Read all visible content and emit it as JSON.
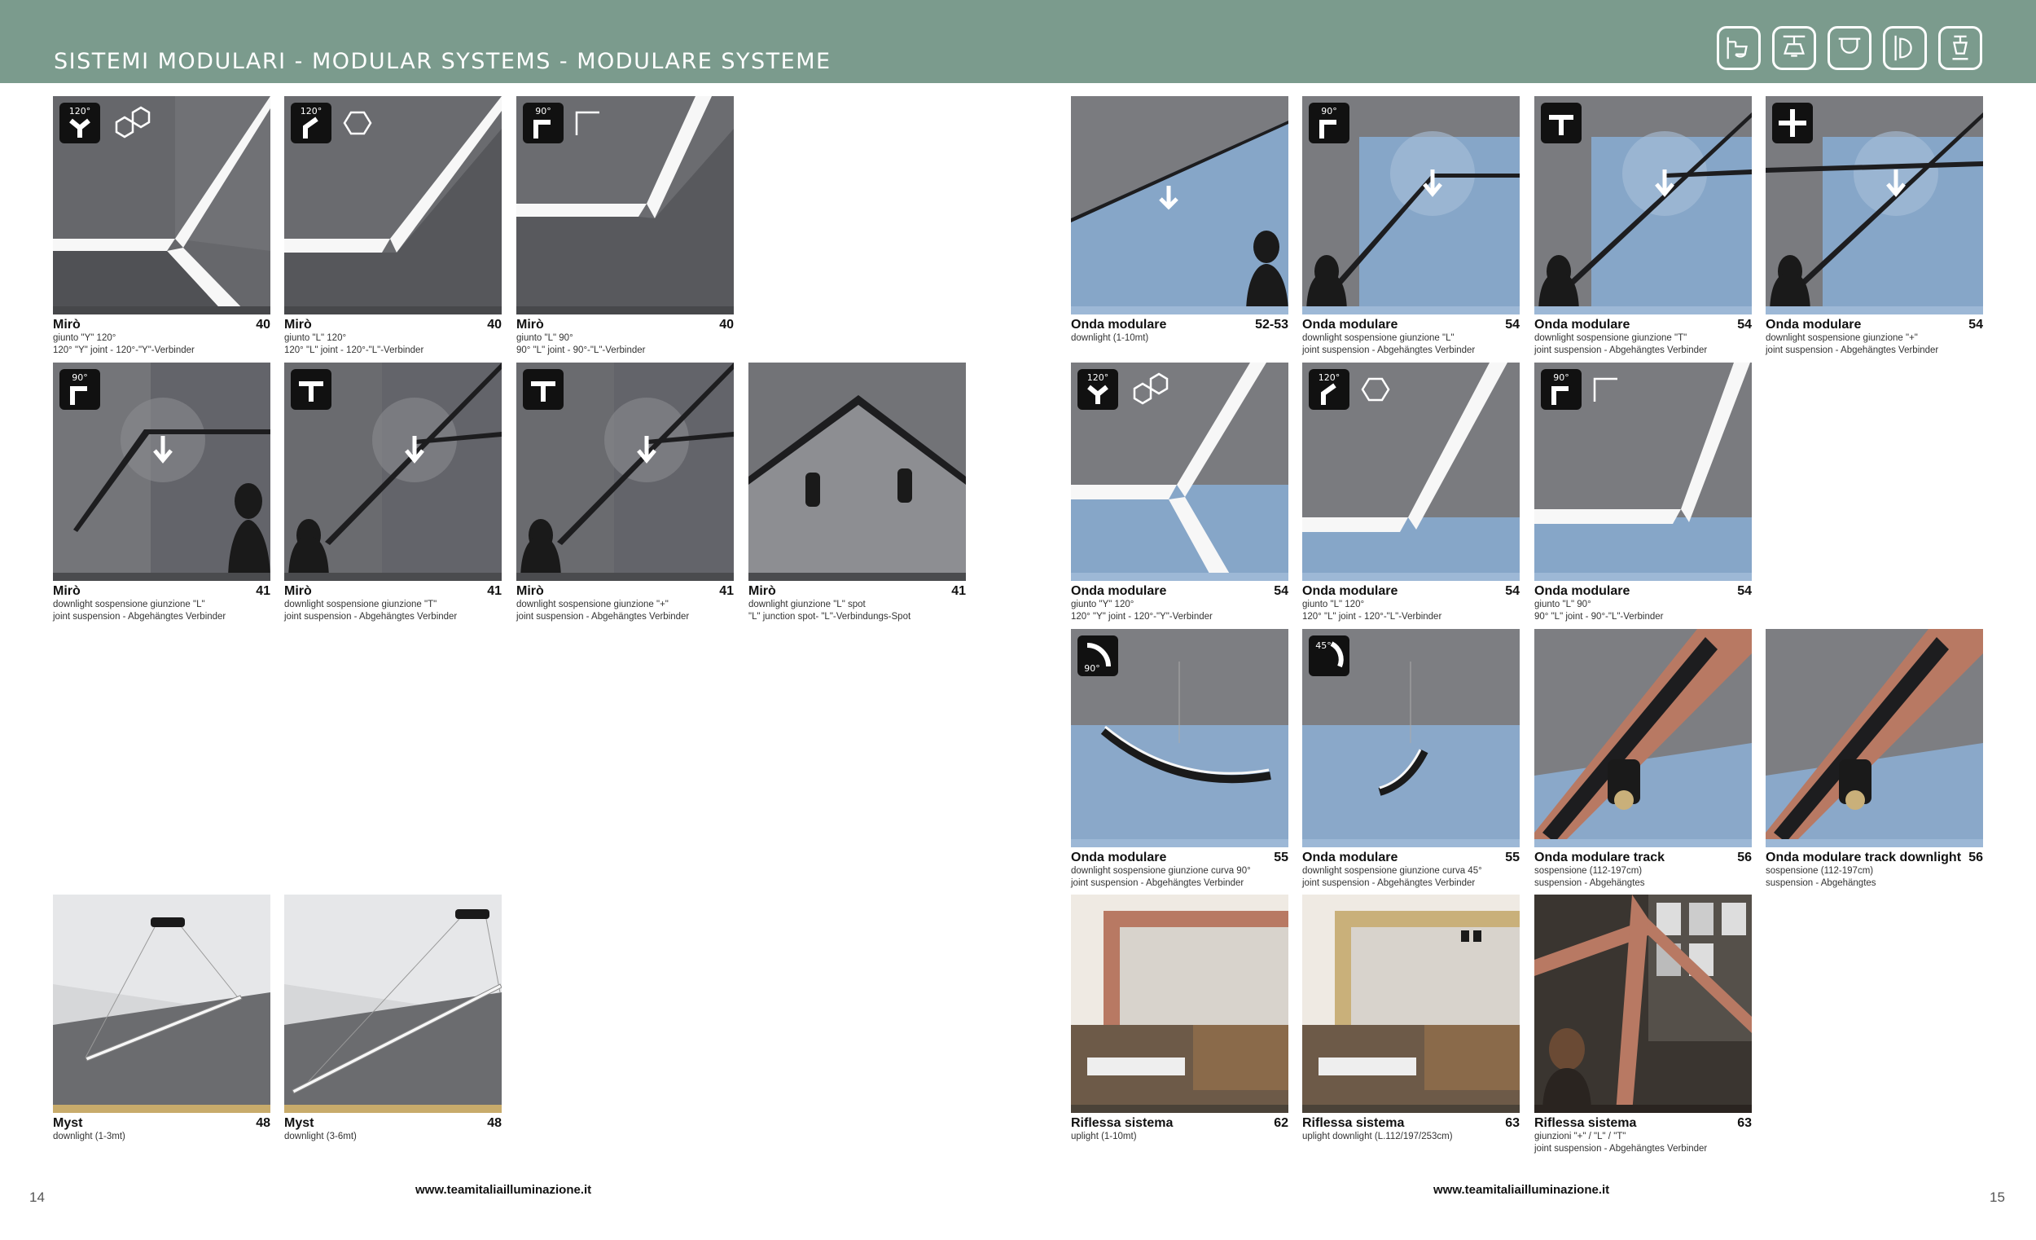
{
  "header": {
    "title": "SISTEMI MODULARI - MODULAR SYSTEMS - MODULARE SYSTEME",
    "icons": [
      "wall-ceiling-icon",
      "pendant-icon",
      "recessed-icon",
      "wall-icon",
      "floor-lamp-icon"
    ]
  },
  "colors": {
    "header": "#7b9b8d",
    "photo_dark": "#5d5e61",
    "photo_blue": "#7fa0c4",
    "copper": "#b87963",
    "gold": "#c9b07a"
  },
  "badges": {
    "y120": "120°",
    "l120": "120°",
    "l90": "90°",
    "curve90": "90°",
    "curve45": "45°"
  },
  "products": [
    {
      "name": "Mirò",
      "page": "40",
      "desc": [
        "giunto \"Y\" 120°",
        "120° \"Y\" joint - 120°-\"Y\"-Verbinder"
      ]
    },
    {
      "name": "Mirò",
      "page": "40",
      "desc": [
        "giunto \"L\" 120°",
        "120° \"L\" joint - 120°-\"L\"-Verbinder"
      ]
    },
    {
      "name": "Mirò",
      "page": "40",
      "desc": [
        "giunto \"L\" 90°",
        "90° \"L\" joint - 90°-\"L\"-Verbinder"
      ]
    },
    {
      "name": "Mirò",
      "page": "41",
      "desc": [
        "downlight sospensione giunzione \"L\"",
        "joint suspension - Abgehängtes Verbinder"
      ]
    },
    {
      "name": "Mirò",
      "page": "41",
      "desc": [
        "downlight sospensione giunzione \"T\"",
        "joint suspension - Abgehängtes Verbinder"
      ]
    },
    {
      "name": "Mirò",
      "page": "41",
      "desc": [
        "downlight sospensione giunzione \"+\"",
        "joint suspension - Abgehängtes Verbinder"
      ]
    },
    {
      "name": "Mirò",
      "page": "41",
      "desc": [
        "downlight giunzione \"L\" spot",
        "\"L\" junction spot- \"L\"-Verbindungs-Spot"
      ]
    },
    {
      "name": "Myst",
      "page": "48",
      "desc": [
        "downlight (1-3mt)"
      ]
    },
    {
      "name": "Myst",
      "page": "48",
      "desc": [
        "downlight (3-6mt)"
      ]
    },
    {
      "name": "Onda modulare",
      "page": "52-53",
      "desc": [
        "downlight (1-10mt)"
      ]
    },
    {
      "name": "Onda modulare",
      "page": "54",
      "desc": [
        "downlight sospensione giunzione \"L\"",
        "joint suspension - Abgehängtes Verbinder"
      ]
    },
    {
      "name": "Onda modulare",
      "page": "54",
      "desc": [
        "downlight sospensione giunzione \"T\"",
        "joint suspension - Abgehängtes Verbinder"
      ]
    },
    {
      "name": "Onda modulare",
      "page": "54",
      "desc": [
        "downlight sospensione giunzione \"+\"",
        "joint suspension - Abgehängtes Verbinder"
      ]
    },
    {
      "name": "Onda modulare",
      "page": "54",
      "desc": [
        "giunto \"Y\" 120°",
        "120° \"Y\" joint - 120°-\"Y\"-Verbinder"
      ]
    },
    {
      "name": "Onda modulare",
      "page": "54",
      "desc": [
        "giunto \"L\" 120°",
        "120° \"L\" joint - 120°-\"L\"-Verbinder"
      ]
    },
    {
      "name": "Onda modulare",
      "page": "54",
      "desc": [
        "giunto \"L\" 90°",
        "90° \"L\" joint - 90°-\"L\"-Verbinder"
      ]
    },
    {
      "name": "Onda modulare",
      "page": "55",
      "desc": [
        "downlight sospensione giunzione curva 90°",
        "joint suspension - Abgehängtes Verbinder"
      ]
    },
    {
      "name": "Onda modulare",
      "page": "55",
      "desc": [
        "downlight sospensione giunzione curva 45°",
        "joint suspension - Abgehängtes Verbinder"
      ]
    },
    {
      "name": "Onda modulare track",
      "page": "56",
      "desc": [
        "sospensione (112-197cm)",
        "suspension - Abgehängtes"
      ]
    },
    {
      "name": "Onda modulare track downlight",
      "page": "56",
      "desc": [
        "sospensione (112-197cm)",
        "suspension - Abgehängtes"
      ]
    },
    {
      "name": "Riflessa sistema",
      "page": "62",
      "desc": [
        "uplight (1-10mt)"
      ]
    },
    {
      "name": "Riflessa sistema",
      "page": "63",
      "desc": [
        "uplight downlight (L.112/197/253cm)"
      ]
    },
    {
      "name": "Riflessa sistema",
      "page": "63",
      "desc": [
        "giunzioni   \"+\" / \"L\" / \"T\"",
        "joint suspension - Abgehängtes Verbinder"
      ]
    }
  ],
  "footer": {
    "left_page": "14",
    "right_page": "15",
    "left_url": "www.teamitaliailluminazione.it",
    "right_url": "www.teamitaliailluminazione.it"
  }
}
